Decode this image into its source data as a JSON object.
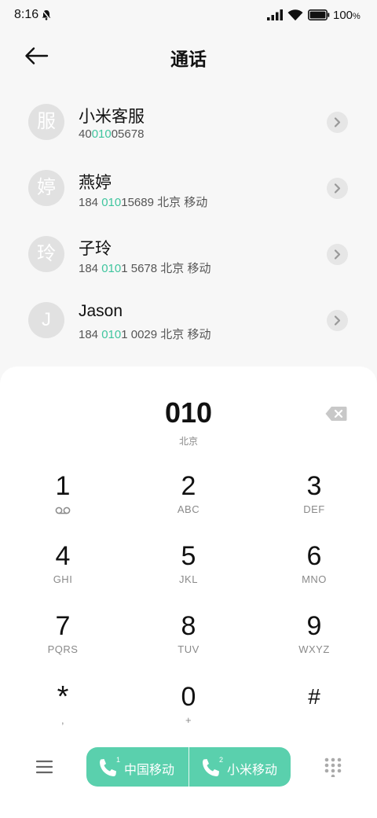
{
  "status_bar": {
    "time": "8:16",
    "battery": "100",
    "battery_unit": "%"
  },
  "header": {
    "title": "通话"
  },
  "contacts": [
    {
      "avatar": "服",
      "name": "小米客服",
      "num_pre": "40",
      "num_hl": "010",
      "num_post": "05678",
      "location": ""
    },
    {
      "avatar": "婷",
      "name": "燕婷",
      "num_pre": "184 ",
      "num_hl": "010",
      "num_post": "15689",
      "location": "北京 移动"
    },
    {
      "avatar": "玲",
      "name": "子玲",
      "num_pre": "184 ",
      "num_hl": "010",
      "num_post": "1 5678",
      "location": "北京 移动"
    },
    {
      "avatar": "J",
      "name": "Jason",
      "num_pre": "184 ",
      "num_hl": "010",
      "num_post": "1 0029",
      "location": "北京 移动"
    }
  ],
  "dialer": {
    "entry": "010",
    "entry_location": "北京"
  },
  "keys": [
    {
      "digit": "1",
      "letters": ""
    },
    {
      "digit": "2",
      "letters": "ABC"
    },
    {
      "digit": "3",
      "letters": "DEF"
    },
    {
      "digit": "4",
      "letters": "GHI"
    },
    {
      "digit": "5",
      "letters": "JKL"
    },
    {
      "digit": "6",
      "letters": "MNO"
    },
    {
      "digit": "7",
      "letters": "PQRS"
    },
    {
      "digit": "8",
      "letters": "TUV"
    },
    {
      "digit": "9",
      "letters": "WXYZ"
    },
    {
      "digit": "*",
      "letters": ","
    },
    {
      "digit": "0",
      "letters": "+"
    },
    {
      "digit": "#",
      "letters": ""
    }
  ],
  "call_buttons": [
    {
      "sim": "1",
      "label": "中国移动"
    },
    {
      "sim": "2",
      "label": "小米移动"
    }
  ],
  "colors": {
    "accent": "#5ad0ad",
    "highlight": "#3fc59e"
  }
}
